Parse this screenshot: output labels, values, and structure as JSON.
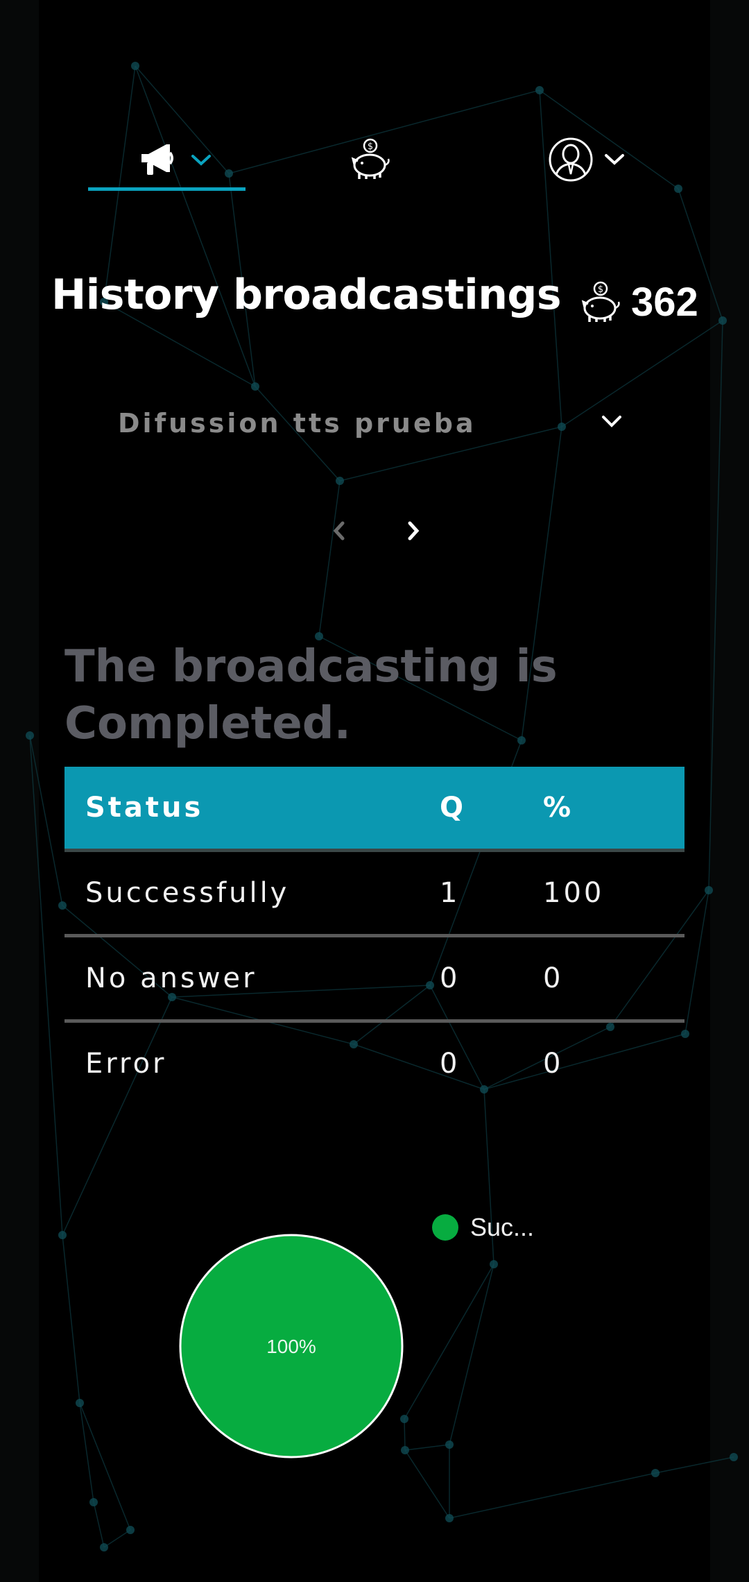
{
  "nav": {
    "items": [
      {
        "name": "broadcast",
        "icon": "megaphone-icon",
        "has_dropdown": true,
        "active": true
      },
      {
        "name": "wallet",
        "icon": "piggy-bank-icon",
        "has_dropdown": false,
        "active": false
      },
      {
        "name": "profile",
        "icon": "user-avatar-icon",
        "has_dropdown": true,
        "active": false
      }
    ]
  },
  "header": {
    "title": "History broadcastings",
    "credits_icon": "piggy-bank-icon",
    "credits": "362"
  },
  "selector": {
    "value": "Difussion tts prueba",
    "icon": "chevron-down-icon"
  },
  "pager": {
    "prev_icon": "chevron-left-icon",
    "next_icon": "chevron-right-icon"
  },
  "status_heading": "The broadcasting is Completed.",
  "table": {
    "headers": [
      "Status",
      "Q",
      "%"
    ],
    "rows": [
      [
        "Successfully",
        "1",
        "100"
      ],
      [
        "No answer",
        "0",
        "0"
      ],
      [
        "Error",
        "0",
        "0"
      ]
    ]
  },
  "chart_data": {
    "type": "pie",
    "legend": [
      {
        "label": "Suc...",
        "color": "#07ac40"
      }
    ],
    "slices": [
      {
        "label": "Successfully",
        "value": 100,
        "percent_label": "100%",
        "color": "#07ac40"
      }
    ],
    "legend_position": "top-right"
  },
  "colors": {
    "accent": "#0aa3bf",
    "table_header": "#0b98b1",
    "success": "#07ac40",
    "heading_muted": "#5b5c63",
    "background": "#000000"
  }
}
